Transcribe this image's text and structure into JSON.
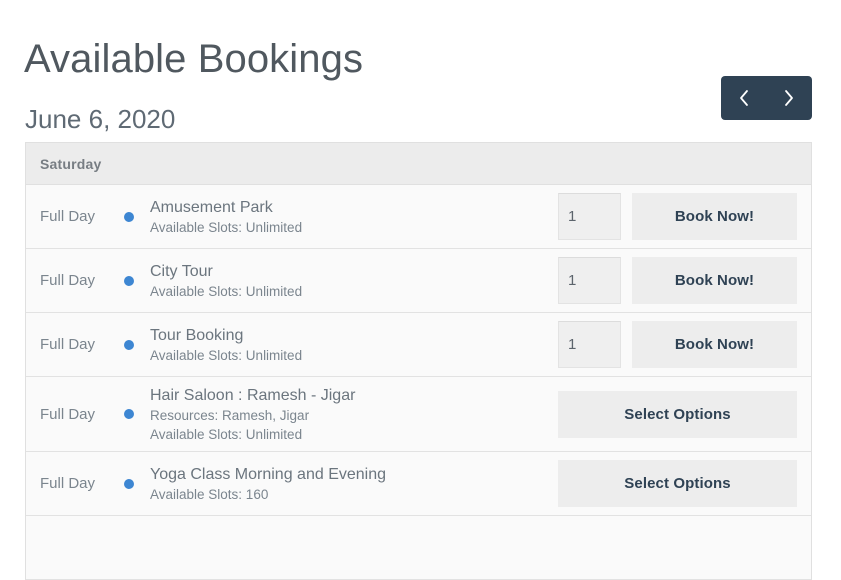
{
  "header": {
    "title": "Available Bookings",
    "date": "June 6, 2020"
  },
  "nav": {
    "prev_icon": "chevron-left-icon",
    "next_icon": "chevron-right-icon",
    "background_color": "#2f4254"
  },
  "table": {
    "day_header": "Saturday",
    "status_dot_color": "#3d86d2",
    "rows": [
      {
        "time": "Full Day",
        "title": "Amusement Park",
        "resources": null,
        "slots": "Available Slots: Unlimited",
        "quantity": "1",
        "action_label": "Book Now!",
        "has_quantity": true
      },
      {
        "time": "Full Day",
        "title": "City Tour",
        "resources": null,
        "slots": "Available Slots: Unlimited",
        "quantity": "1",
        "action_label": "Book Now!",
        "has_quantity": true
      },
      {
        "time": "Full Day",
        "title": "Tour Booking",
        "resources": null,
        "slots": "Available Slots: Unlimited",
        "quantity": "1",
        "action_label": "Book Now!",
        "has_quantity": true
      },
      {
        "time": "Full Day",
        "title": "Hair Saloon : Ramesh - Jigar",
        "resources": "Resources: Ramesh, Jigar",
        "slots": "Available Slots: Unlimited",
        "quantity": null,
        "action_label": "Select Options",
        "has_quantity": false
      },
      {
        "time": "Full Day",
        "title": "Yoga Class Morning and Evening",
        "resources": null,
        "slots": "Available Slots: 160",
        "quantity": null,
        "action_label": "Select Options",
        "has_quantity": false
      }
    ]
  }
}
